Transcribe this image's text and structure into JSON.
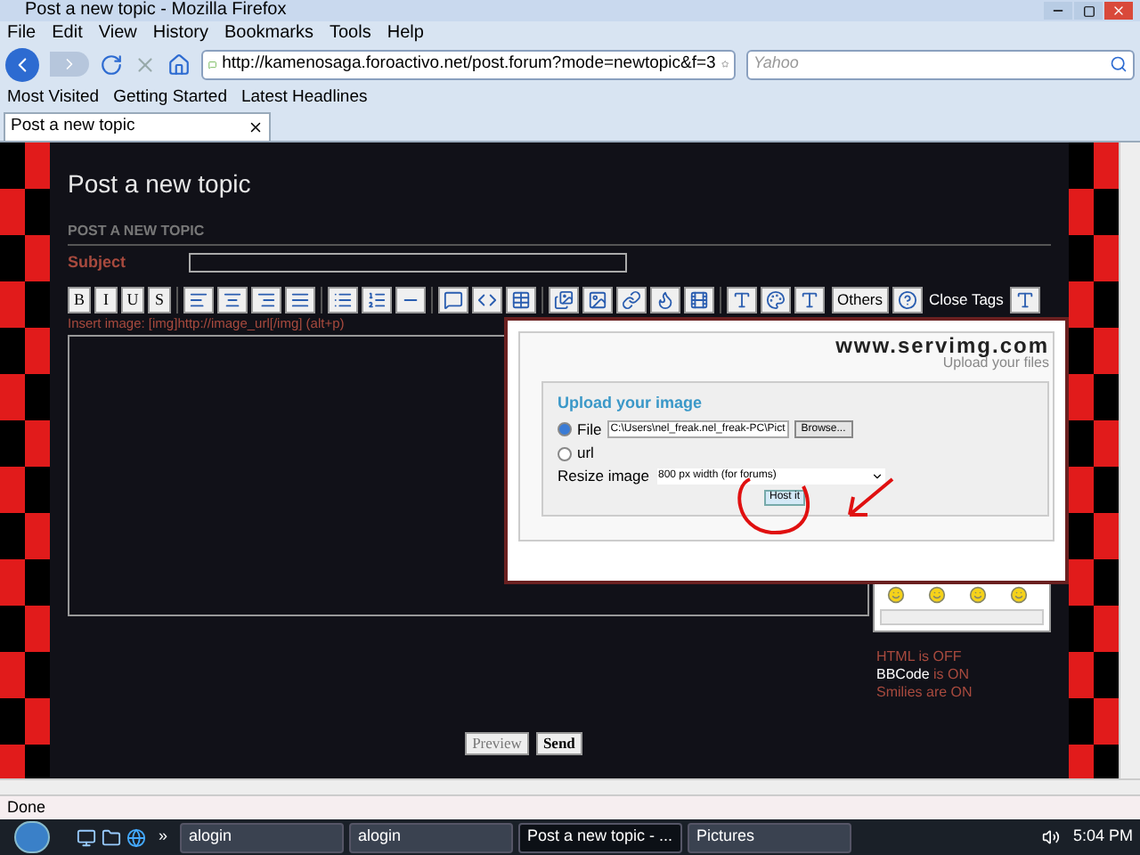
{
  "window": {
    "title": "Post a new topic - Mozilla Firefox"
  },
  "menu": [
    "File",
    "Edit",
    "View",
    "History",
    "Bookmarks",
    "Tools",
    "Help"
  ],
  "address": {
    "value": "http://kamenosaga.foroactivo.net/post.forum?mode=newtopic&f=3"
  },
  "search": {
    "placeholder": "Yahoo"
  },
  "bookmarks": [
    "Most Visited",
    "Getting Started",
    "Latest Headlines"
  ],
  "tabs": [
    {
      "label": "Post a new topic",
      "selected": true
    }
  ],
  "page": {
    "heading": "Post a new topic",
    "section": "POST A NEW TOPIC",
    "subject_label": "Subject",
    "format_buttons": [
      "B",
      "I",
      "U",
      "S"
    ],
    "others": "Others",
    "close_tags": "Close Tags",
    "hint": "Insert image: [img]http://image_url[/img] (alt+p)",
    "settings": [
      {
        "name": "HTML",
        "state": "is OFF",
        "highlight": false
      },
      {
        "name": "BBCode",
        "state": "is ON",
        "highlight": true
      },
      {
        "name": "Smilies",
        "state": "are ON",
        "highlight": false
      }
    ],
    "buttons": [
      "Preview",
      "Send"
    ]
  },
  "popup": {
    "logo": "www.servimg.com",
    "tagline": "Upload your files",
    "title": "Upload your image",
    "sources": [
      {
        "label": "File",
        "selected": true
      },
      {
        "label": "url",
        "selected": false
      }
    ],
    "file_value": "C:\\Users\\nel_freak.nel_freak-PC\\Pict",
    "browse": "Browse...",
    "resize_label": "Resize image",
    "resize_value": "800 px width (for forums)",
    "submit": "Host it"
  },
  "status_bar": "Done",
  "taskbar": {
    "more": "»",
    "items": [
      {
        "label": "alogin",
        "selected": false
      },
      {
        "label": "alogin",
        "selected": false
      },
      {
        "label": "Post a new topic - ...",
        "selected": true
      },
      {
        "label": "Pictures",
        "selected": false
      }
    ],
    "clock": "5:04 PM"
  }
}
